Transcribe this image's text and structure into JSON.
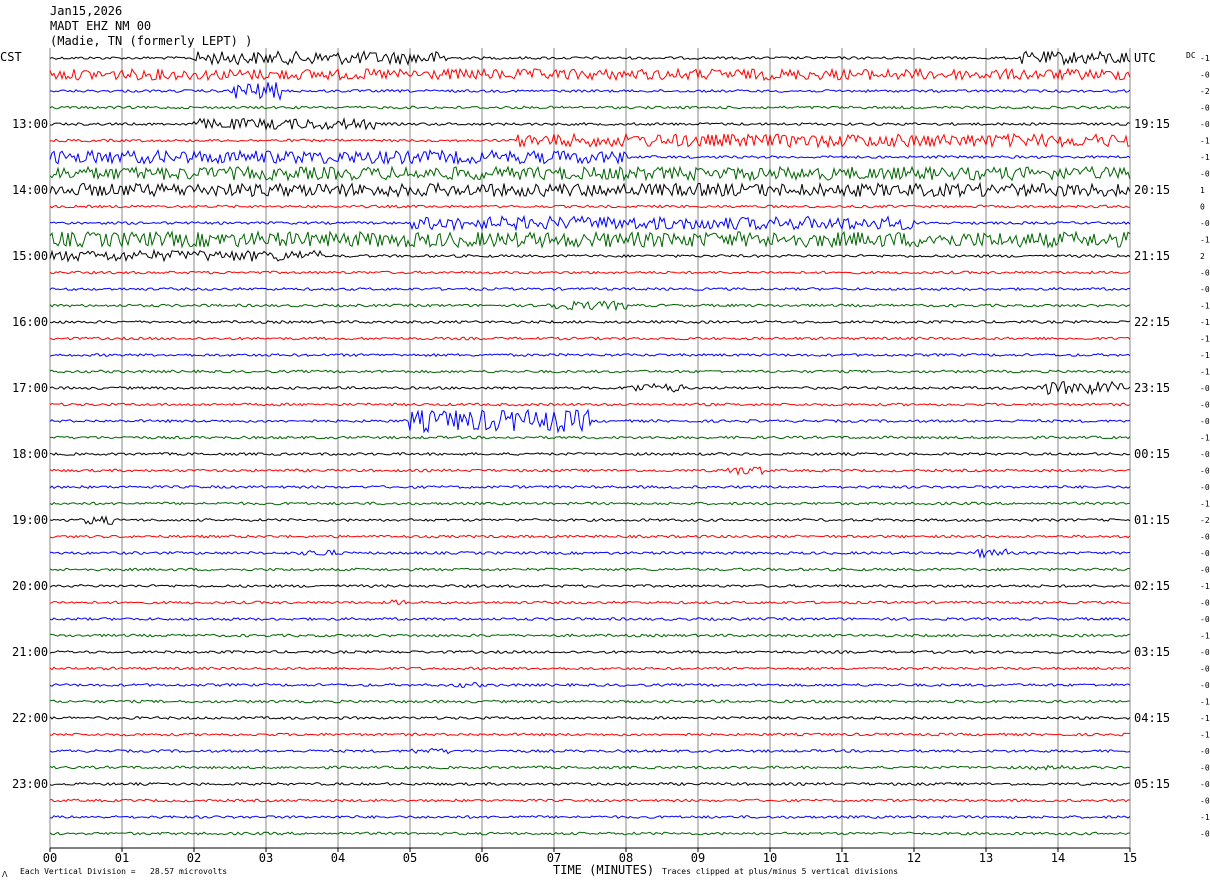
{
  "header": {
    "date": "Jan15,2026",
    "station": "MADT EHZ NM 00",
    "location": "(Madie, TN (formerly LEPT) )"
  },
  "left_tz": "CST",
  "right_tz": "UTC",
  "dc_label": "DC",
  "footer": {
    "scale_text": "Each Vertical Division =   28.57 microvolts",
    "xlabel": "TIME (MINUTES)",
    "clip_text": "Traces clipped at plus/minus 5 vertical divisions",
    "corner_mark": "ⴷ"
  },
  "chart_data": {
    "type": "line",
    "title": "MADT EHZ NM 00",
    "xlabel": "TIME (MINUTES)",
    "xlim": [
      0,
      15
    ],
    "x_ticks": [
      "00",
      "01",
      "02",
      "03",
      "04",
      "05",
      "06",
      "07",
      "08",
      "09",
      "10",
      "11",
      "12",
      "13",
      "14",
      "15"
    ],
    "hour_labels_left": [
      "13:00",
      "14:00",
      "15:00",
      "16:00",
      "17:00",
      "18:00",
      "19:00",
      "20:00",
      "21:00",
      "22:00",
      "23:00"
    ],
    "hour_labels_right": [
      "UTC",
      "19:15",
      "20:15",
      "21:15",
      "22:15",
      "23:15",
      "00:15",
      "01:15",
      "02:15",
      "03:15",
      "04:15",
      "05:15"
    ],
    "dc_offsets": [
      "-1",
      "-0",
      "-2",
      "-0",
      "-0",
      "-1",
      "-1",
      "-0",
      "1",
      "0",
      "-0",
      "-1",
      "2",
      "-0",
      "-0",
      "-1",
      "-1",
      "-1",
      "-1",
      "-1",
      "-0",
      "-0",
      "-0",
      "-1",
      "-0",
      "-0",
      "-0",
      "-1",
      "-2",
      "-0",
      "-0",
      "-0",
      "-1",
      "-0",
      "-0",
      "-1",
      "-0",
      "-0",
      "-0",
      "-1",
      "-1",
      "-1",
      "-0",
      "-0",
      "-0",
      "-0",
      "-1",
      "-0",
      "-1",
      "-0"
    ],
    "trace_colors": [
      "#000000",
      "#ff0000",
      "#0000ff",
      "#006400"
    ],
    "trace_count": 48,
    "grid": true,
    "clip_divisions": 5,
    "microvolts_per_division": 28.57,
    "activity": [
      {
        "trace": 0,
        "t0": 2.0,
        "t1": 5.5,
        "amp": 3
      },
      {
        "trace": 0,
        "t0": 13.5,
        "t1": 15,
        "amp": 3
      },
      {
        "trace": 1,
        "t0": 0.0,
        "t1": 15,
        "amp": 2.5
      },
      {
        "trace": 2,
        "t0": 2.5,
        "t1": 3.2,
        "amp": 4
      },
      {
        "trace": 4,
        "t0": 2.0,
        "t1": 4.5,
        "amp": 2.5
      },
      {
        "trace": 5,
        "t0": 6.5,
        "t1": 15,
        "amp": 3
      },
      {
        "trace": 6,
        "t0": 0.0,
        "t1": 8,
        "amp": 3
      },
      {
        "trace": 7,
        "t0": 0.0,
        "t1": 15,
        "amp": 3
      },
      {
        "trace": 8,
        "t0": 0.0,
        "t1": 15,
        "amp": 3
      },
      {
        "trace": 10,
        "t0": 5.0,
        "t1": 12,
        "amp": 3
      },
      {
        "trace": 11,
        "t0": 0.0,
        "t1": 15,
        "amp": 3.5
      },
      {
        "trace": 12,
        "t0": 0.0,
        "t1": 3.8,
        "amp": 2.5
      },
      {
        "trace": 15,
        "t0": 6.9,
        "t1": 8.0,
        "amp": 2
      },
      {
        "trace": 20,
        "t0": 8.0,
        "t1": 8.8,
        "amp": 2
      },
      {
        "trace": 20,
        "t0": 13.7,
        "t1": 14.9,
        "amp": 3
      },
      {
        "trace": 22,
        "t0": 5.0,
        "t1": 7.5,
        "amp": 5
      },
      {
        "trace": 25,
        "t0": 9.4,
        "t1": 9.9,
        "amp": 2
      },
      {
        "trace": 28,
        "t0": 0.5,
        "t1": 0.9,
        "amp": 2
      },
      {
        "trace": 30,
        "t0": 12.8,
        "t1": 13.3,
        "amp": 2
      },
      {
        "trace": 30,
        "t0": 3.5,
        "t1": 4.0,
        "amp": 1.5
      },
      {
        "trace": 33,
        "t0": 4.7,
        "t1": 5.0,
        "amp": 1.2
      },
      {
        "trace": 38,
        "t0": 5.6,
        "t1": 6.0,
        "amp": 1.2
      },
      {
        "trace": 42,
        "t0": 5.0,
        "t1": 5.6,
        "amp": 1.2
      },
      {
        "trace": 43,
        "t0": 13.6,
        "t1": 14.2,
        "amp": 1
      }
    ]
  }
}
